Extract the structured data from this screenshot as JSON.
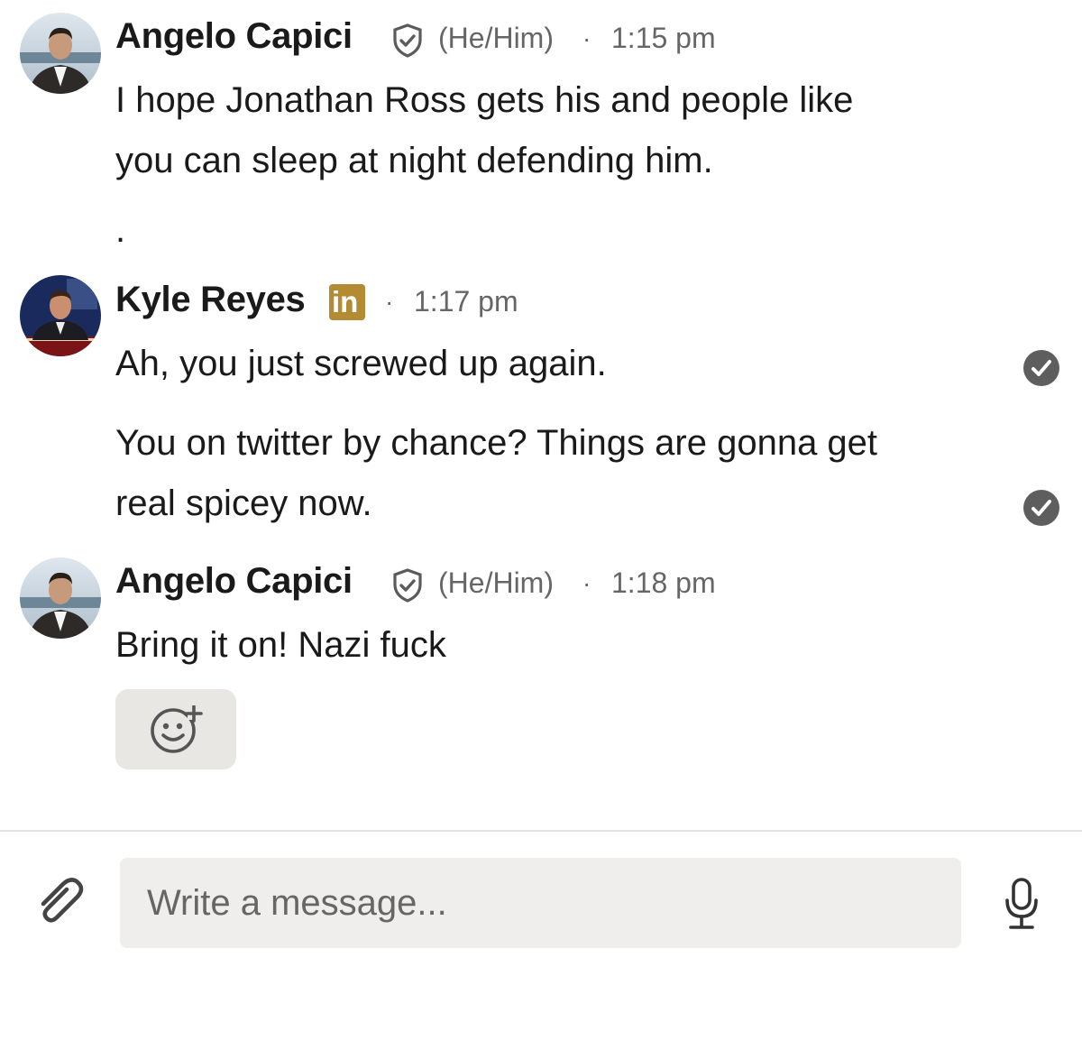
{
  "messages": [
    {
      "sender": "Angelo Capici",
      "badge": "verified-shield-icon",
      "pronouns": "(He/Him)",
      "separator": "·",
      "time": "1:15 pm",
      "lines": [
        "I hope Jonathan Ross gets his and people like",
        "you can sleep at night defending him.",
        "."
      ]
    },
    {
      "sender": "Kyle Reyes",
      "badge": "linkedin-premium-icon",
      "badge_text": "in",
      "badge_color": "#b28b33",
      "separator": "·",
      "time": "1:17 pm",
      "paragraphs": [
        {
          "lines": [
            "Ah, you just screwed up again."
          ],
          "status": "read-check-icon"
        },
        {
          "lines": [
            "You on twitter by chance?  Things are gonna get",
            "real spicey now."
          ],
          "status": "read-check-icon"
        }
      ]
    },
    {
      "sender": "Angelo Capici",
      "badge": "verified-shield-icon",
      "pronouns": "(He/Him)",
      "separator": "·",
      "time": "1:18 pm",
      "lines": [
        "Bring it on! Nazi fuck"
      ]
    }
  ],
  "reaction_button_icon": "add-reaction-icon",
  "composer": {
    "placeholder": "Write a message...",
    "attach_icon": "paperclip-icon",
    "mic_icon": "microphone-icon"
  },
  "colors": {
    "text": "#1a1a1a",
    "muted": "#666666",
    "composer_bg": "#efeeec",
    "reaction_bg": "#e9e7e3"
  }
}
